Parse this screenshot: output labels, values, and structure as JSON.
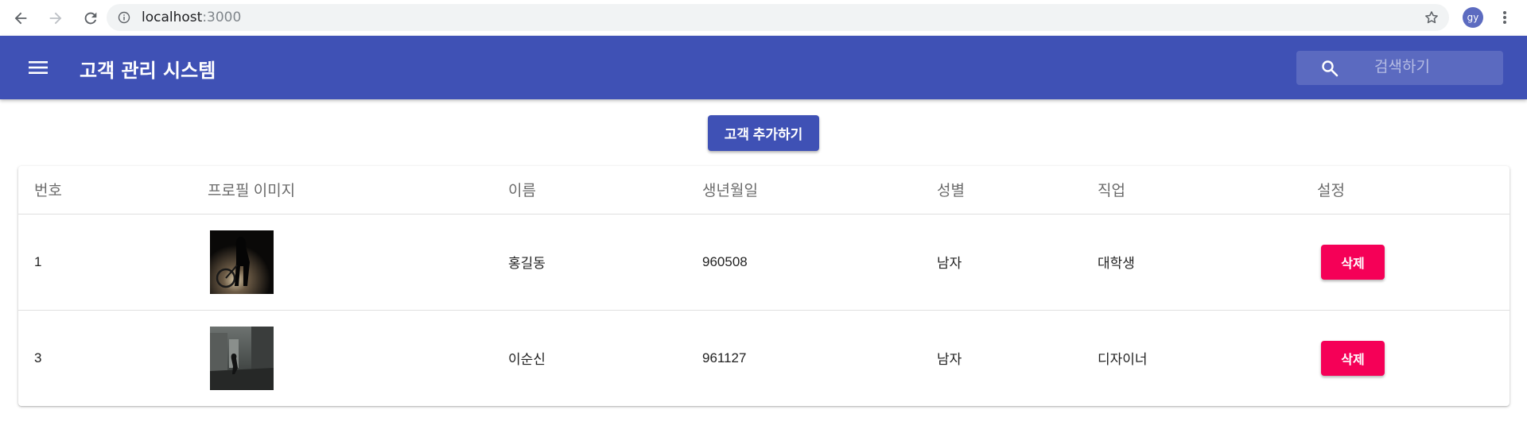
{
  "browser": {
    "url_host": "localhost",
    "url_port": ":3000",
    "profile_initials": "gy"
  },
  "appbar": {
    "title": "고객 관리 시스템",
    "search_placeholder": "검색하기",
    "bg_color": "#3f51b5"
  },
  "actions": {
    "add_customer_label": "고객 추가하기"
  },
  "table": {
    "headers": [
      "번호",
      "프로필 이미지",
      "이름",
      "생년월일",
      "성별",
      "직업",
      "설정"
    ],
    "rows": [
      {
        "id": "1",
        "image": "dark-figure-photo",
        "name": "홍길동",
        "birthday": "960508",
        "gender": "남자",
        "job": "대학생",
        "action": "삭제"
      },
      {
        "id": "3",
        "image": "gray-street-photo",
        "name": "이순신",
        "birthday": "961127",
        "gender": "남자",
        "job": "디자이너",
        "action": "삭제"
      }
    ]
  },
  "colors": {
    "primary": "#3f51b5",
    "secondary": "#f50057"
  }
}
